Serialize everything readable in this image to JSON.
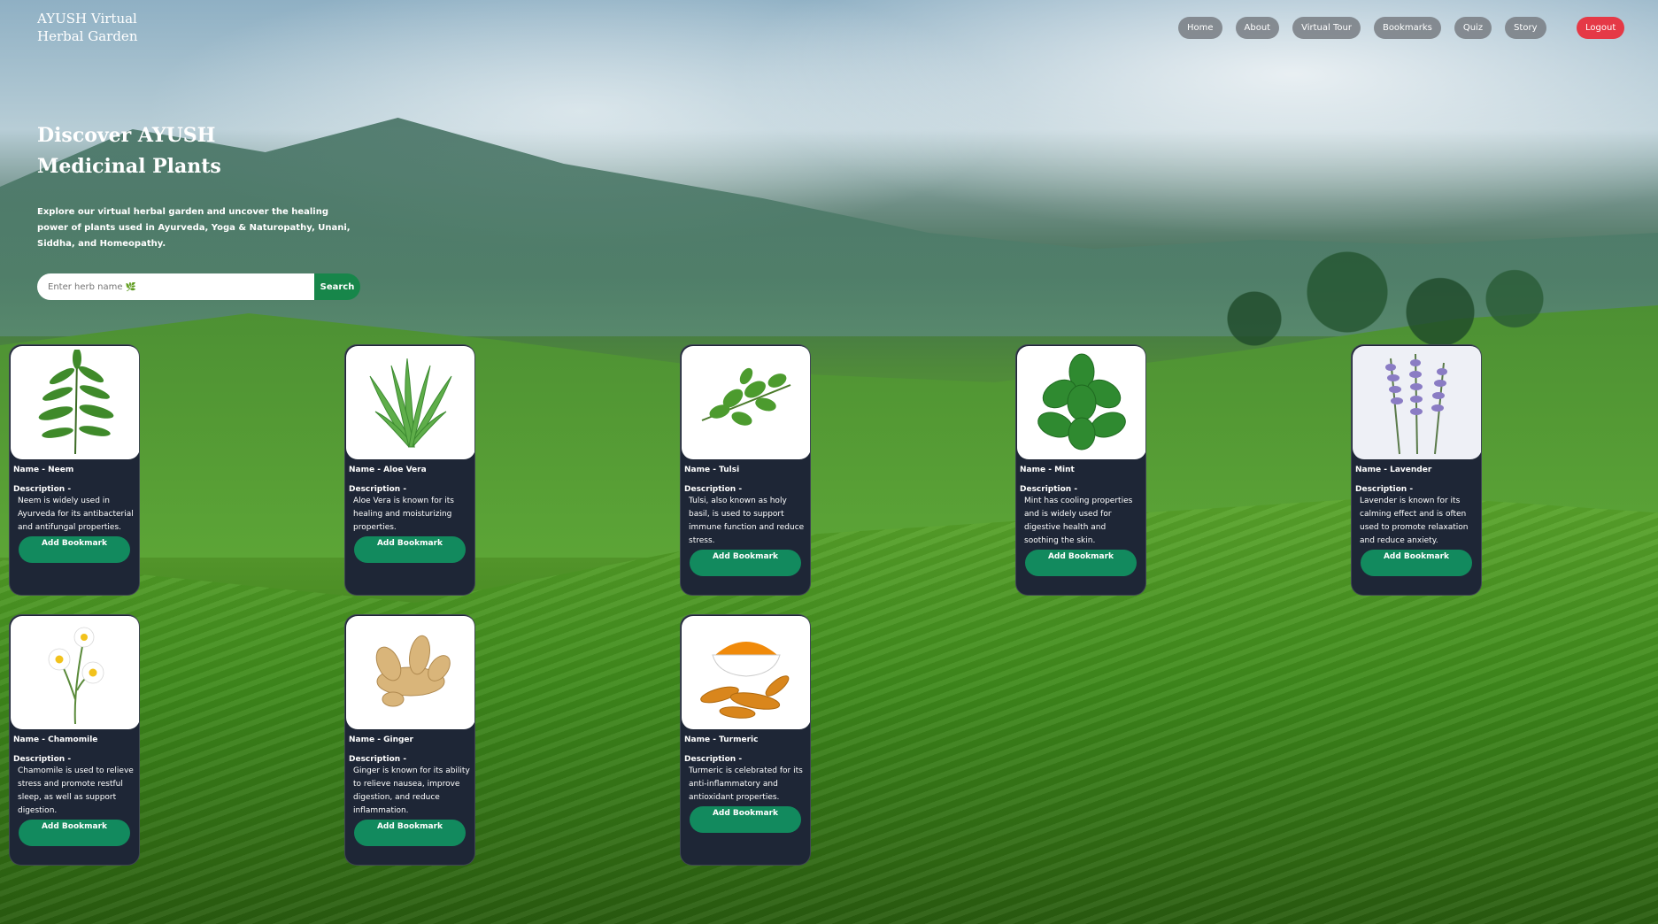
{
  "brand": {
    "title": "AYUSH Virtual Herbal Garden"
  },
  "nav": {
    "items": [
      "Home",
      "About",
      "Virtual Tour",
      "Bookmarks",
      "Quiz",
      "Story"
    ],
    "logout": "Logout"
  },
  "hero": {
    "title": "Discover AYUSH Medicinal Plants",
    "description": "Explore our virtual herbal garden and uncover the healing power of plants used in Ayurveda, Yoga & Naturopathy, Unani, Siddha, and Homeopathy."
  },
  "search": {
    "placeholder": "Enter herb name 🌿",
    "button": "Search"
  },
  "card_labels": {
    "name_prefix": "Name - ",
    "description_heading": "Description -",
    "bookmark_button": "Add Bookmark"
  },
  "plants": [
    {
      "name": "Neem",
      "description": "Neem is widely used in Ayurveda for its antibacterial and antifungal properties.",
      "icon": "neem-leaf-image"
    },
    {
      "name": "Aloe Vera",
      "description": "Aloe Vera is known for its healing and moisturizing properties.",
      "icon": "aloe-vera-image"
    },
    {
      "name": "Tulsi",
      "description": "Tulsi, also known as holy basil, is used to support immune function and reduce stress.",
      "icon": "tulsi-image"
    },
    {
      "name": "Mint",
      "description": "Mint has cooling properties and is widely used for digestive health and soothing the skin.",
      "icon": "mint-image"
    },
    {
      "name": "Lavender",
      "description": "Lavender is known for its calming effect and is often used to promote relaxation and reduce anxiety.",
      "icon": "lavender-image"
    },
    {
      "name": "Chamomile",
      "description": "Chamomile is used to relieve stress and promote restful sleep, as well as support digestion.",
      "icon": "chamomile-image"
    },
    {
      "name": "Ginger",
      "description": "Ginger is known for its ability to relieve nausea, improve digestion, and reduce inflammation.",
      "icon": "ginger-image"
    },
    {
      "name": "Turmeric",
      "description": "Turmeric is celebrated for its anti-inflammatory and antioxidant properties.",
      "icon": "turmeric-image"
    }
  ],
  "colors": {
    "card_bg": "#1e2636",
    "bookmark_button": "#128a5e",
    "search_button": "#17864a",
    "logout": "#e53946",
    "nav_pill": "#787d82"
  }
}
